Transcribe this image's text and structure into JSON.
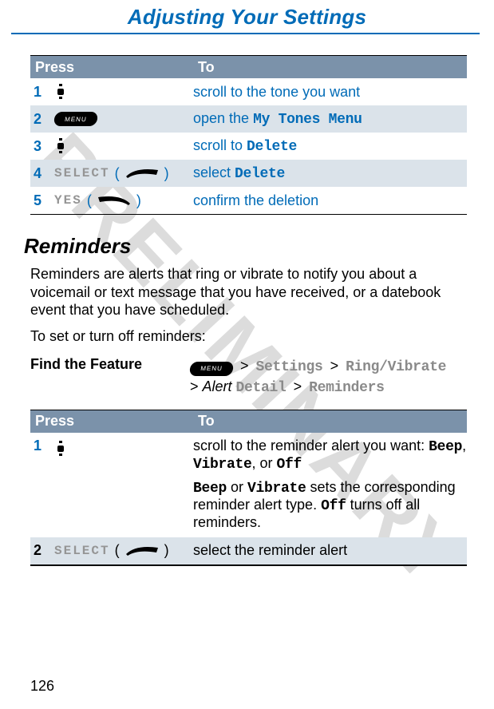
{
  "header": {
    "title": "Adjusting Your Settings"
  },
  "watermark": "PRELIMINARY",
  "page_number": "126",
  "table1": {
    "head_press": "Press",
    "head_to": "To",
    "rows": [
      {
        "num": "1",
        "icon": "scroll",
        "desc_pre": "scroll to the tone you want"
      },
      {
        "num": "2",
        "icon": "menu",
        "desc_pre": "open the ",
        "desc_mono": "My Tones Menu"
      },
      {
        "num": "3",
        "icon": "scroll",
        "desc_pre": "scroll to ",
        "desc_mono": "Delete"
      },
      {
        "num": "4",
        "label": "SELECT",
        "key": "right",
        "desc_pre": "select ",
        "desc_mono": "Delete"
      },
      {
        "num": "5",
        "label": "YES",
        "key": "left",
        "desc_pre": "confirm the deletion"
      }
    ]
  },
  "section": {
    "heading": "Reminders",
    "body1": "Reminders are alerts that ring or vibrate to notify you about a voicemail or text message that you have received, or a datebook event that you have scheduled.",
    "body2": "To set or turn off reminders:"
  },
  "find": {
    "label": "Find the Feature",
    "menu_label": "MENU",
    "path1_a": "Settings",
    "path1_b": "Ring/Vibrate",
    "path2_pre": "Alert",
    "path2_mono_a": "Detail",
    "path2_mono_b": "Reminders"
  },
  "table2": {
    "head_press": "Press",
    "head_to": "To",
    "row1": {
      "num": "1",
      "line1_pre": "scroll to the reminder alert you want: ",
      "line1_a": "Beep",
      "line1_sep1": ", ",
      "line1_b": "Vibrate",
      "line1_sep2": ", or ",
      "line1_c": "Off",
      "line2_a": "Beep",
      "line2_mid": " or ",
      "line2_b": "Vibrate",
      "line2_post": " sets the corresponding reminder alert type. ",
      "line2_c": "Off",
      "line2_end": " turns off all reminders."
    },
    "row2": {
      "num": "2",
      "label": "SELECT",
      "desc": "select the reminder alert"
    }
  }
}
